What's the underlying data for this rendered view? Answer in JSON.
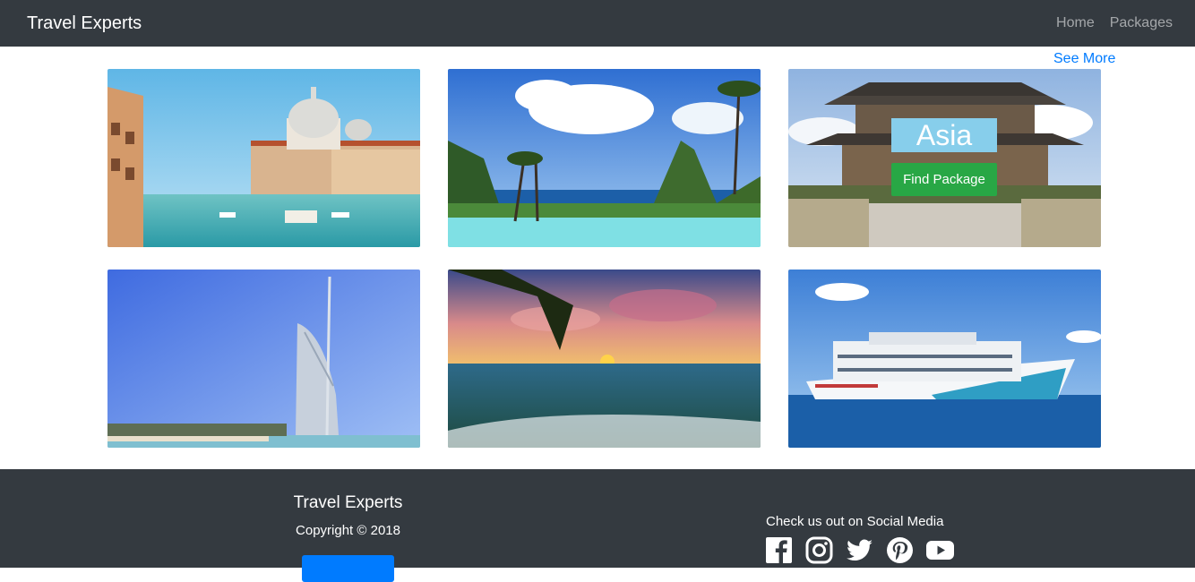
{
  "nav": {
    "brand": "Travel Experts",
    "links": [
      {
        "label": "Home"
      },
      {
        "label": "Packages"
      }
    ]
  },
  "see_more": "See More",
  "cards": [
    {
      "scene": "venice-canal"
    },
    {
      "scene": "tropical-pool-pitons"
    },
    {
      "scene": "asian-temple",
      "overlay_title": "Asia",
      "overlay_button": "Find Package"
    },
    {
      "scene": "burj-al-arab"
    },
    {
      "scene": "sunset-beach"
    },
    {
      "scene": "cruise-ship"
    }
  ],
  "footer": {
    "title": "Travel Experts",
    "copyright": "Copyright © 2018",
    "social_text": "Check us out on Social Media",
    "social": [
      "facebook-icon",
      "instagram-icon",
      "twitter-icon",
      "pinterest-icon",
      "youtube-icon"
    ]
  },
  "colors": {
    "navbar": "#343a40",
    "link_blue": "#007bff",
    "button_green": "#28a745",
    "overlay_sky": "#87ceeb"
  }
}
